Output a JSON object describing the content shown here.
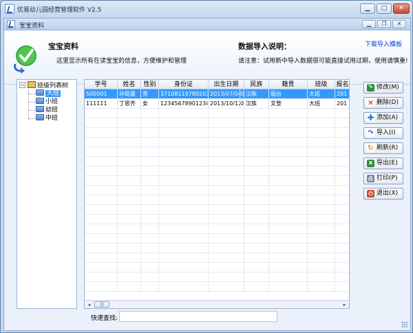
{
  "window": {
    "title": "优易幼儿园经营管理软件 V2.5",
    "controls": [
      "minimize-icon",
      "maximize-icon",
      "close-icon"
    ]
  },
  "child_window": {
    "title": "宝宝资料",
    "controls": [
      "minimize-icon",
      "restore-icon",
      "close-icon"
    ]
  },
  "banner": {
    "title": "宝宝资料",
    "description": "这里显示所有在读宝宝的信息，方便维护和管理",
    "import_title": "数据导入说明：",
    "import_note": "请注意：试用新中导入数据很可能直接试用过期，使用请慎重!",
    "download_link": "下载导入模板"
  },
  "tree": {
    "root": "班级列表树",
    "items": [
      "大班",
      "小班",
      "幼班",
      "中班"
    ],
    "selected_index": 0
  },
  "grid": {
    "columns": [
      "学号",
      "姓名",
      "性别",
      "身份证",
      "出生日期",
      "民族",
      "籍贯",
      "班级",
      "报名"
    ],
    "rows": [
      [
        "S00001",
        "孙铤童",
        "男",
        "371081197802030077",
        "2013/07/04",
        "0",
        "汉族",
        "烟台",
        "大班",
        "201"
      ],
      [
        "111111",
        "丁思齐",
        "女",
        "123456789012345678",
        "2013/10/12",
        "0",
        "汉族",
        "文登",
        "大班",
        "201"
      ]
    ],
    "selected_row": 0
  },
  "buttons": [
    {
      "label": "修改(M)",
      "icon": "edit-icon",
      "color": "#2f8f3a"
    },
    {
      "label": "删除(D)",
      "icon": "delete-icon",
      "color": "#d42020"
    },
    {
      "label": "添加(A)",
      "icon": "add-icon",
      "color": "#1f6fd6"
    },
    {
      "label": "导入(I)",
      "icon": "import-icon",
      "color": "#2a66b8"
    },
    {
      "label": "刷新(R)",
      "icon": "refresh-icon",
      "color": "#d9861a"
    },
    {
      "label": "导出(E)",
      "icon": "export-icon",
      "color": "#2f8f3a"
    },
    {
      "label": "打印(P)",
      "icon": "print-icon",
      "color": "#7a8595"
    },
    {
      "label": "退出(X)",
      "icon": "exit-icon",
      "color": "#d24a2a"
    }
  ],
  "search": {
    "label": "快速查找:",
    "value": ""
  },
  "colors": {
    "selection": "#3399ff",
    "link": "#0a3fd6",
    "frame": "#c4d8ee"
  }
}
